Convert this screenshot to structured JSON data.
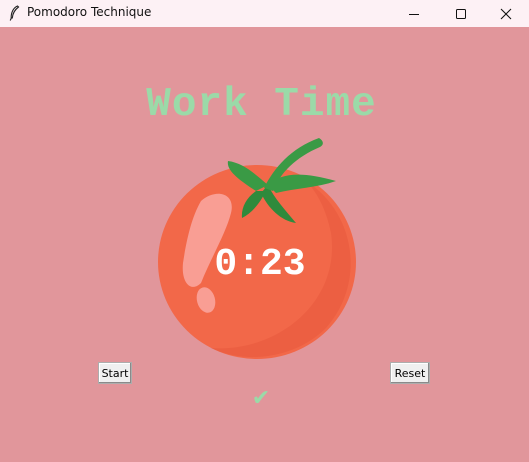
{
  "window": {
    "title": "Pomodoro Technique",
    "app_icon": "feather-icon",
    "controls": {
      "minimize_icon": "minimize-icon",
      "maximize_icon": "maximize-icon",
      "close_icon": "close-icon"
    }
  },
  "main": {
    "heading": "Work Time",
    "timer": "0:23",
    "tomato_image": "tomato-icon",
    "start_label": "Start",
    "reset_label": "Reset",
    "check_marks": "✔"
  },
  "colors": {
    "background": "#e1969b",
    "accent_green": "#9bdaa8",
    "tomato_red": "#f26849",
    "leaf_green": "#3a9a45",
    "timer_text": "#ffffff"
  }
}
